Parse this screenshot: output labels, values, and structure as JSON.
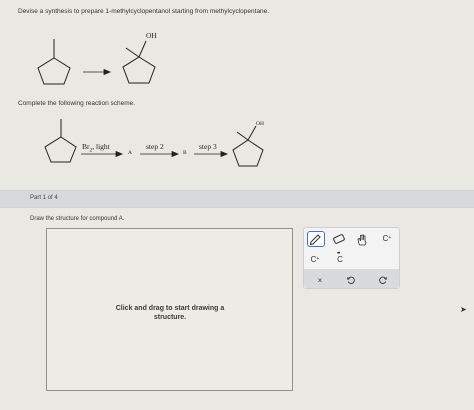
{
  "question": {
    "prompt": "Devise a synthesis to prepare 1-methylcyclopentanol starting from methylcyclopentane.",
    "complete_scheme": "Complete the following reaction scheme."
  },
  "scheme_top": {
    "product_group": "OH"
  },
  "scheme_bottom": {
    "step1_reagent": "Br",
    "step1_subscript": "2",
    "step1_suffix": ", light",
    "intermediate_a": "A",
    "step2": "step 2",
    "intermediate_b": "B",
    "step3": "step 3",
    "product_group": "OH"
  },
  "part": {
    "label": "Part 1 of 4",
    "draw_prompt": "Draw the structure for compound A."
  },
  "canvas": {
    "hint": "Click and drag to start drawing a structure."
  },
  "toolbox": {
    "carbon_plus": "C",
    "carbon_minus": "C",
    "carbon_radical": "C",
    "carbon_top": "C",
    "clear": "×"
  },
  "icons": {
    "pencil": "pencil-icon",
    "eraser": "eraser-icon",
    "hand": "hand-icon",
    "undo": "undo-icon",
    "redo": "redo-icon"
  },
  "colors": {
    "background": "#e9e8e3",
    "part_band": "#d7d9dc",
    "selected_tool_border": "#4a72c4"
  }
}
